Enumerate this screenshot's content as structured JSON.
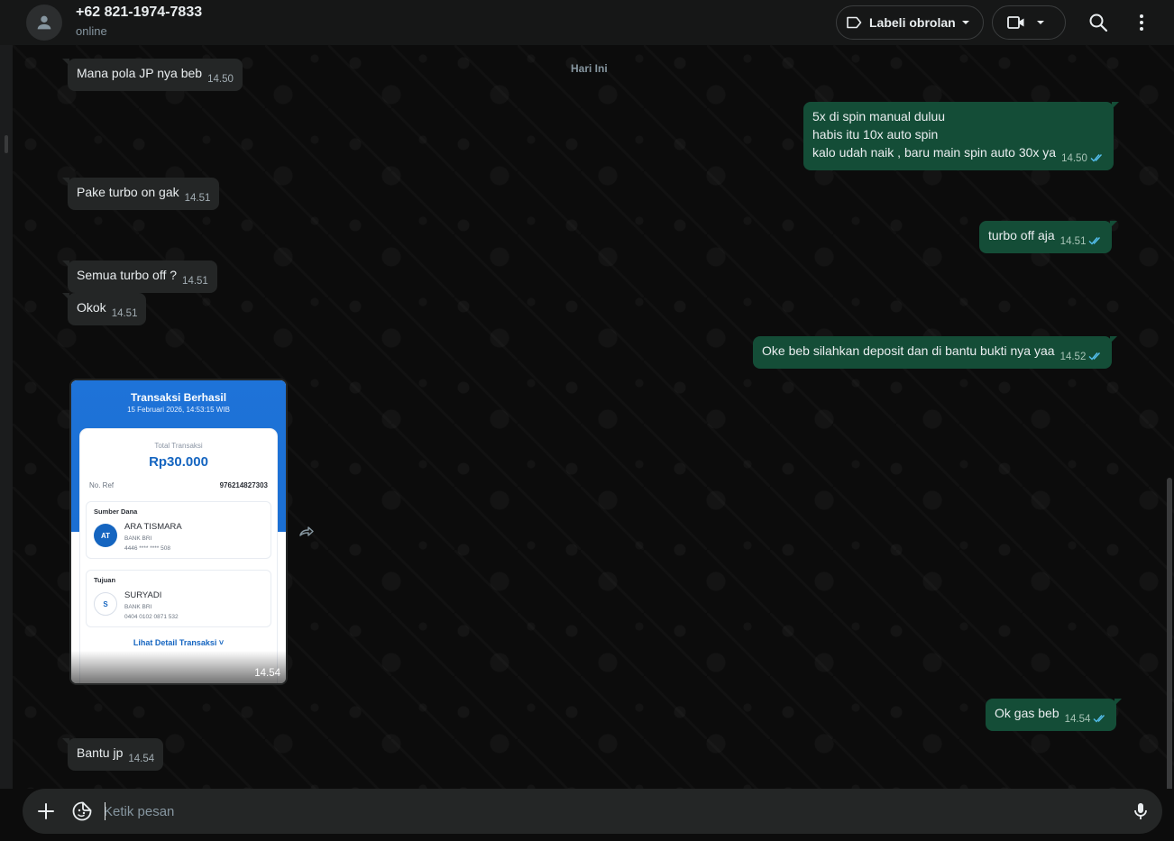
{
  "header": {
    "contact_name": "+62 821-1974-7833",
    "status": "online",
    "label_button": "Labeli obrolan"
  },
  "chat": {
    "date_chip": "Hari Ini",
    "messages": [
      {
        "dir": "in",
        "lines": [
          "Mana pola JP nya beb"
        ],
        "time": "14.50"
      },
      {
        "dir": "out",
        "lines": [
          "5x di spin manual duluu",
          "habis itu 10x auto spin",
          "kalo udah naik , baru main spin auto 30x ya"
        ],
        "time": "14.50"
      },
      {
        "dir": "in",
        "lines": [
          "Pake turbo on gak"
        ],
        "time": "14.51"
      },
      {
        "dir": "out",
        "lines": [
          "turbo off aja"
        ],
        "time": "14.51"
      },
      {
        "dir": "in",
        "lines": [
          "Semua turbo off ?"
        ],
        "time": "14.51"
      },
      {
        "dir": "in",
        "lines": [
          "Okok"
        ],
        "time": "14.51"
      },
      {
        "dir": "out",
        "lines": [
          "Oke beb silahkan deposit dan di bantu bukti nya yaa"
        ],
        "time": "14.52"
      },
      {
        "dir": "out",
        "lines": [
          "Ok gas beb"
        ],
        "time": "14.54"
      },
      {
        "dir": "in",
        "lines": [
          "Bantu jp"
        ],
        "time": "14.54"
      }
    ],
    "image_message": {
      "time": "14.54",
      "receipt": {
        "title": "Transaksi Berhasil",
        "datetime": "15 Februari 2026, 14:53:15 WIB",
        "total_label": "Total Transaksi",
        "total_value": "Rp30.000",
        "ref_label": "No. Ref",
        "ref_value": "976214827303",
        "source": {
          "heading": "Sumber Dana",
          "initials": "AT",
          "name": "ARA TISMARA",
          "bank": "BANK BRI",
          "account": "4446 **** **** 508"
        },
        "destination": {
          "heading": "Tujuan",
          "initials": "S",
          "name": "SURYADI",
          "bank": "BANK BRI",
          "account": "0404 0102 0871 532"
        },
        "detail_link": "Lihat Detail Transaksi ˅"
      }
    }
  },
  "composer": {
    "placeholder": "Ketik pesan"
  },
  "icons": {
    "avatar": "person-icon",
    "label": "label-tag-icon",
    "video": "video-camera-icon",
    "search": "search-icon",
    "menu": "more-vertical-icon",
    "forward": "forward-icon",
    "plus": "plus-icon",
    "sticker": "sticker-icon",
    "mic": "microphone-icon"
  },
  "colors": {
    "incoming_bubble": "#242626",
    "outgoing_bubble": "#144d37",
    "read_ticks": "#53bdeb",
    "receipt_blue": "#1565c0"
  }
}
